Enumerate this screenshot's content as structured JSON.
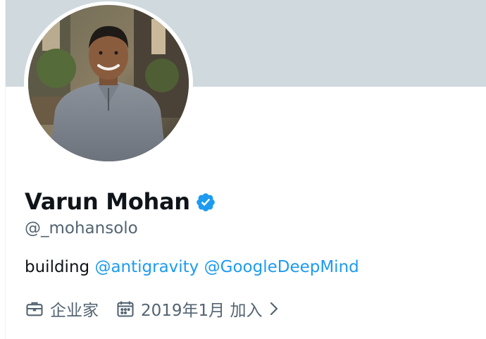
{
  "profile": {
    "name": "Varun Mohan",
    "handle": "@_mohansolo",
    "bio_text": "building",
    "bio_mention_1": "@antigravity",
    "bio_mention_2": "@GoogleDeepMind",
    "profession": "企业家",
    "joined": "2019年1月 加入",
    "verified_icon": "verified-badge-icon",
    "profession_icon": "briefcase-icon",
    "joined_icon": "calendar-icon"
  },
  "colors": {
    "banner": "#cfd9de",
    "link": "#1d9bf0",
    "secondary_text": "#536471",
    "primary_text": "#0f1419",
    "verified": "#1d9bf0"
  }
}
